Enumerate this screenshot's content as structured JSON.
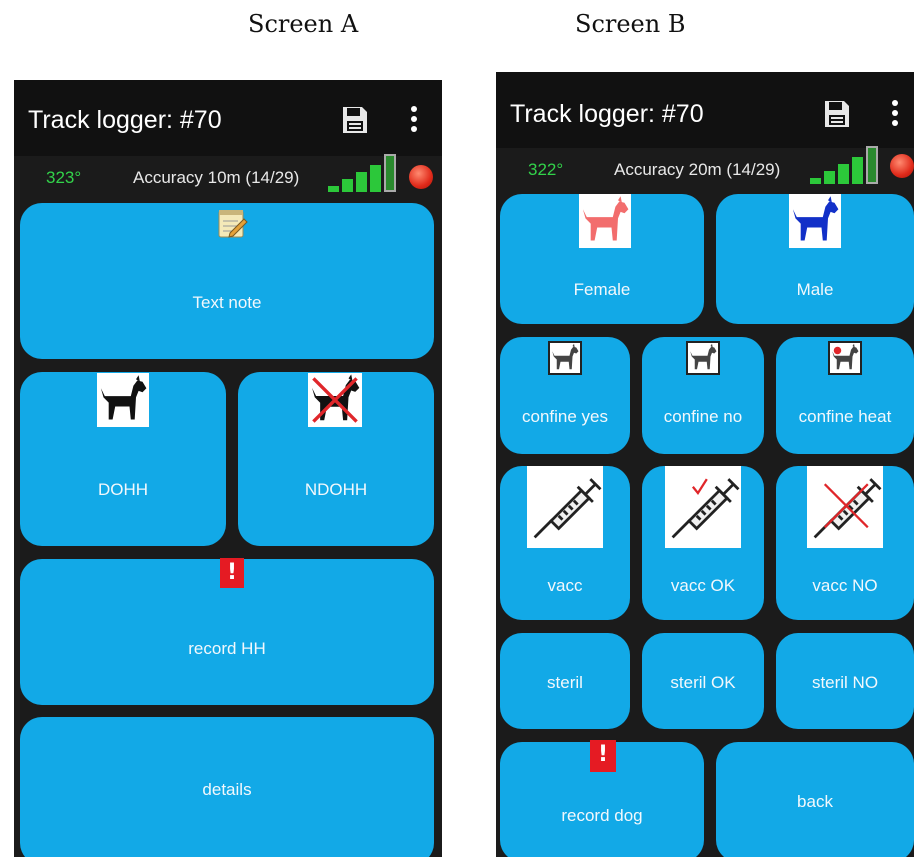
{
  "captions": {
    "a": "Screen A",
    "b": "Screen B"
  },
  "screen_a": {
    "title": "Track logger: #70",
    "heading": "323°",
    "accuracy": "Accuracy 10m (14/29)",
    "buttons": {
      "text_note": "Text note",
      "dohh": "DOHH",
      "ndohh": "NDOHH",
      "record_hh": "record HH",
      "details": "details"
    }
  },
  "screen_b": {
    "title": "Track logger: #70",
    "heading": "322°",
    "accuracy": "Accuracy 20m (14/29)",
    "buttons": {
      "female": "Female",
      "male": "Male",
      "confine_yes": "confine yes",
      "confine_no": "confine no",
      "confine_heat": "confine heat",
      "vacc": "vacc",
      "vacc_ok": "vacc OK",
      "vacc_no": "vacc NO",
      "steril": "steril",
      "steril_ok": "steril OK",
      "steril_no": "steril NO",
      "record_dog": "record dog",
      "back": "back"
    }
  },
  "icons": {
    "save": "floppy-disk-icon",
    "menu": "overflow-menu-icon",
    "signal": "signal-strength-icon",
    "record": "record-icon",
    "note": "notepad-icon",
    "dog": "dog-icon",
    "dog_crossed": "dog-crossed-icon",
    "alert": "exclamation-icon",
    "syringe": "syringe-icon"
  },
  "colors": {
    "tile": "#12a9e7",
    "background": "#1b1b1b",
    "heading": "#32d24a",
    "alert": "#e51b23"
  }
}
